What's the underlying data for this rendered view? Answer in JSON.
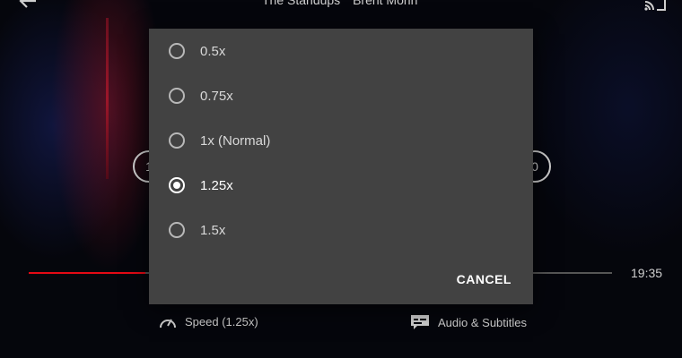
{
  "player": {
    "show_title": "The Standups",
    "episode_title": "Brent Morin",
    "skip_back_label": "1",
    "skip_forward_label": "0",
    "time_remaining": "19:35",
    "progress_fraction": 0.2,
    "accent_color": "#e50914"
  },
  "controls": {
    "speed_label": "Speed (1.25x)",
    "audio_label": "Audio & Subtitles"
  },
  "speed_dialog": {
    "options": [
      {
        "label": "0.5x",
        "selected": false
      },
      {
        "label": "0.75x",
        "selected": false
      },
      {
        "label": "1x (Normal)",
        "selected": false
      },
      {
        "label": "1.25x",
        "selected": true
      },
      {
        "label": "1.5x",
        "selected": false
      }
    ],
    "cancel_label": "CANCEL"
  }
}
